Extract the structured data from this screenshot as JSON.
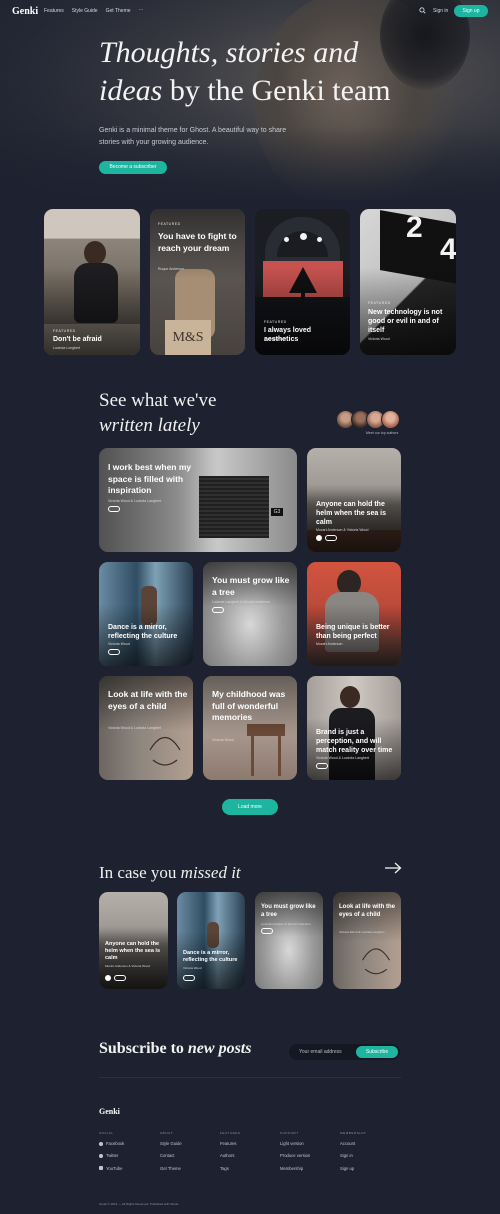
{
  "header": {
    "logo": "Genki",
    "nav": [
      "Features",
      "Style Guide",
      "Get Theme"
    ],
    "more": "···",
    "signin": "Sign in",
    "signup": "Sign up"
  },
  "hero": {
    "title_italic1": "Thoughts, stories and",
    "title_italic2": "ideas",
    "title_rest": " by the Genki team",
    "description": "Genki is a minimal theme for Ghost. A beautiful way to share stories with your growing audience.",
    "cta": "Become a subscriber"
  },
  "featured": [
    {
      "tag": "FEATURED",
      "title": "Don't be afraid",
      "author": "Lucinda Longbert"
    },
    {
      "tag": "FEATURED",
      "title": "You have to fight to reach your dream",
      "author": "Roque Anderson"
    },
    {
      "tag": "FEATURED",
      "title": "I always loved aesthetics",
      "author": "Victoria Wood"
    },
    {
      "tag": "FEATURED",
      "title": "New technology is not good or evil in and of itself",
      "author": "Victoria Wood"
    }
  ],
  "latest": {
    "title_plain": "See what we've",
    "title_italic": "written lately",
    "meet": "Meet our top authors",
    "posts": [
      {
        "title": "I work best when my space is filled with inspiration",
        "author": "Victoria Wood & Lucinda Langbert"
      },
      {
        "title": "Anyone can hold the helm when the sea is calm",
        "author": "Mozart Anderson & Victoria Wood"
      },
      {
        "title": "Dance is a mirror, reflecting the culture",
        "author": "Victoria Wood"
      },
      {
        "title": "You must grow like a tree",
        "author": "Lucinda Langbert & Mozart Anderson"
      },
      {
        "title": "Being unique is better than being perfect",
        "author": "Mozart Anderson"
      },
      {
        "title": "Look at life with the eyes of a child",
        "author": "Victoria Wood & Lucinda Langbert"
      },
      {
        "title": "My childhood was full of wonderful memories",
        "author": "Victoria Wood"
      },
      {
        "title": "Brand is just a perception, and will match reality over time",
        "author": "Victoria Wood & Lucinda Langbert"
      }
    ],
    "load_more": "Load more"
  },
  "missed": {
    "title_plain": "In case you",
    "title_italic": "missed it",
    "posts": [
      {
        "title": "Anyone can hold the helm when the sea is calm",
        "author": "Mozart Anderson & Victoria Wood"
      },
      {
        "title": "Dance is a mirror, reflecting the culture",
        "author": "Victoria Wood"
      },
      {
        "title": "You must grow like a tree",
        "author": "Lucinda Langbert & Mozart Anderson"
      },
      {
        "title": "Look at life with the eyes of a child",
        "author": "Victoria Wood & Lucinda Langbert"
      }
    ]
  },
  "subscribe": {
    "title_plain": "Subscribe to",
    "title_italic": "new posts",
    "placeholder": "Your email address",
    "button": "Subscribe"
  },
  "footer": {
    "logo": "Genki",
    "columns": [
      {
        "heading": "SOCIAL",
        "links": [
          "Facebook",
          "Twitter",
          "YouTube"
        ]
      },
      {
        "heading": "ABOUT",
        "links": [
          "Style Guide",
          "Contact",
          "Get Theme"
        ]
      },
      {
        "heading": "FEATURES",
        "links": [
          "Features",
          "Authors",
          "Tags"
        ]
      },
      {
        "heading": "SUPPORT",
        "links": [
          "Light version",
          "Produce version",
          "Membership"
        ]
      },
      {
        "heading": "MEMBERSHIP",
        "links": [
          "Account",
          "Sign in",
          "Sign up"
        ]
      }
    ],
    "copyright": "Genki © 2021 — All Rights Reserved. Published with Ghost."
  },
  "colors": {
    "accent": "#1eb5a0",
    "background": "#1e2230"
  }
}
